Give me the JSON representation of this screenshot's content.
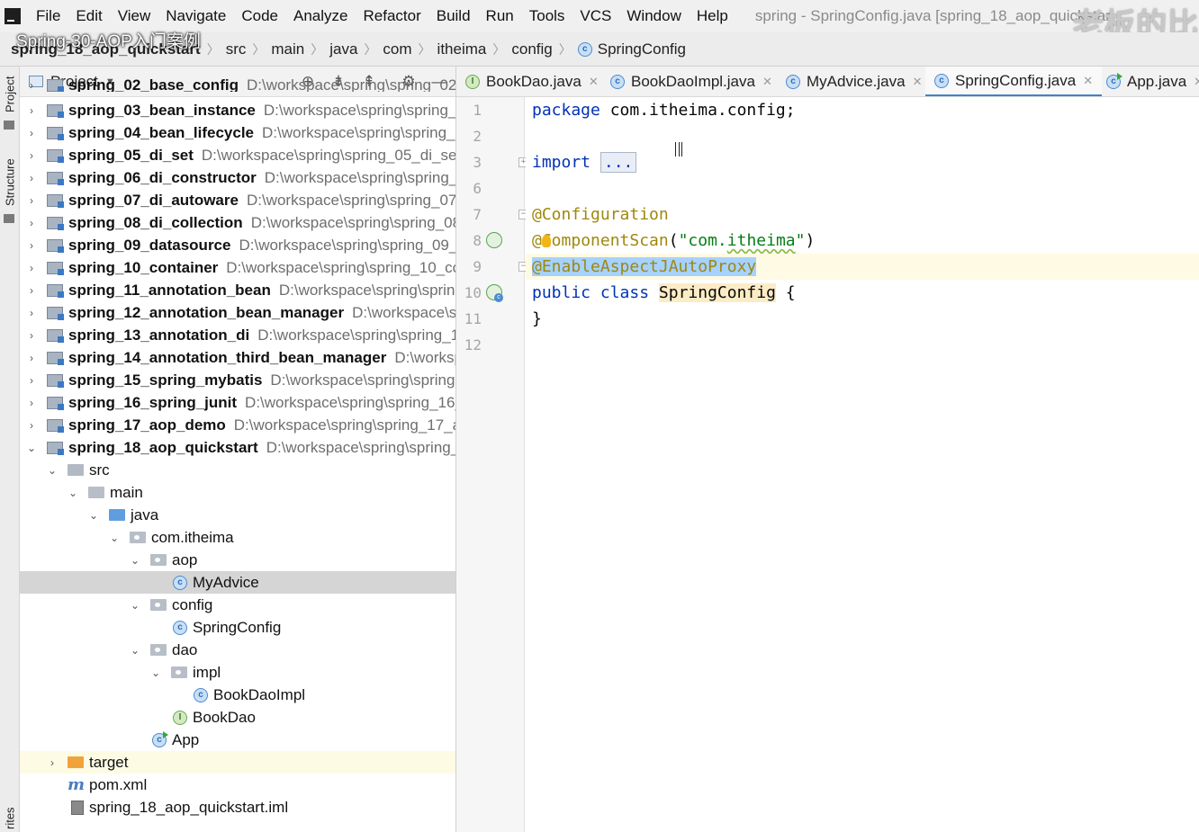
{
  "menubar": {
    "items": [
      "File",
      "Edit",
      "View",
      "Navigate",
      "Code",
      "Analyze",
      "Refactor",
      "Build",
      "Run",
      "Tools",
      "VCS",
      "Window",
      "Help"
    ],
    "window_title": "spring - SpringConfig.java [spring_18_aop_quickstar",
    "watermark": "老板的比"
  },
  "video_title": "Spring-30-AOP入门案例",
  "breadcrumb": [
    "spring_18_aop_quickstart",
    "src",
    "main",
    "java",
    "com",
    "itheima",
    "config",
    "SpringConfig"
  ],
  "left_strip": {
    "project_tab": "Project",
    "structure_tab": "Structure",
    "favorites_tab": "rites"
  },
  "project_panel": {
    "title": "Project",
    "tree": [
      {
        "name": "spring_02_base_config",
        "path": "D:\\workspace\\spring\\spring_02_",
        "bold": true
      },
      {
        "name": "spring_03_bean_instance",
        "path": "D:\\workspace\\spring\\spring_0",
        "bold": true
      },
      {
        "name": "spring_04_bean_lifecycle",
        "path": "D:\\workspace\\spring\\spring_0",
        "bold": true
      },
      {
        "name": "spring_05_di_set",
        "path": "D:\\workspace\\spring\\spring_05_di_set",
        "bold": true
      },
      {
        "name": "spring_06_di_constructor",
        "path": "D:\\workspace\\spring\\spring_",
        "bold": true
      },
      {
        "name": "spring_07_di_autoware",
        "path": "D:\\workspace\\spring\\spring_07",
        "bold": true
      },
      {
        "name": "spring_08_di_collection",
        "path": "D:\\workspace\\spring\\spring_08",
        "bold": true
      },
      {
        "name": "spring_09_datasource",
        "path": "D:\\workspace\\spring\\spring_09_",
        "bold": true
      },
      {
        "name": "spring_10_container",
        "path": "D:\\workspace\\spring\\spring_10_co",
        "bold": true
      },
      {
        "name": "spring_11_annotation_bean",
        "path": "D:\\workspace\\spring\\sprin",
        "bold": true
      },
      {
        "name": "spring_12_annotation_bean_manager",
        "path": "D:\\workspace\\sp",
        "bold": true
      },
      {
        "name": "spring_13_annotation_di",
        "path": "D:\\workspace\\spring\\spring_1",
        "bold": true
      },
      {
        "name": "spring_14_annotation_third_bean_manager",
        "path": "D:\\worksp",
        "bold": true
      },
      {
        "name": "spring_15_spring_mybatis",
        "path": "D:\\workspace\\spring\\spring",
        "bold": true
      },
      {
        "name": "spring_16_spring_junit",
        "path": "D:\\workspace\\spring\\spring_16_",
        "bold": true
      },
      {
        "name": "spring_17_aop_demo",
        "path": "D:\\workspace\\spring\\spring_17_a",
        "bold": true
      },
      {
        "name": "spring_18_aop_quickstart",
        "path": "D:\\workspace\\spring\\spring_",
        "bold": true
      },
      {
        "name": "src",
        "path": ""
      },
      {
        "name": "main",
        "path": ""
      },
      {
        "name": "java",
        "path": ""
      },
      {
        "name": "com.itheima",
        "path": ""
      },
      {
        "name": "aop",
        "path": ""
      },
      {
        "name": "MyAdvice",
        "path": ""
      },
      {
        "name": "config",
        "path": ""
      },
      {
        "name": "SpringConfig",
        "path": ""
      },
      {
        "name": "dao",
        "path": ""
      },
      {
        "name": "impl",
        "path": ""
      },
      {
        "name": "BookDaoImpl",
        "path": ""
      },
      {
        "name": "BookDao",
        "path": ""
      },
      {
        "name": "App",
        "path": ""
      },
      {
        "name": "target",
        "path": ""
      },
      {
        "name": "pom.xml",
        "path": ""
      },
      {
        "name": "spring_18_aop_quickstart.iml",
        "path": ""
      }
    ]
  },
  "editor": {
    "tabs": [
      {
        "label": "BookDao.java",
        "icon": "interface-icon",
        "badge": "I"
      },
      {
        "label": "BookDaoImpl.java",
        "icon": "class-icon",
        "badge": "c"
      },
      {
        "label": "MyAdvice.java",
        "icon": "class-icon",
        "badge": "c"
      },
      {
        "label": "SpringConfig.java",
        "icon": "class-icon",
        "badge": "c",
        "active": true
      },
      {
        "label": "App.java",
        "icon": "runnable-class-icon",
        "badge": "c"
      }
    ],
    "line_numbers": [
      "1",
      "2",
      "3",
      "6",
      "7",
      "8",
      "9",
      "10",
      "11",
      "12"
    ],
    "code": {
      "package_kw": "package",
      "package_name": " com.itheima.config;",
      "import_kw": "import",
      "import_folded": "...",
      "ann_configuration": "@Configuration",
      "ann_cs_at": "@",
      "ann_cs_rest": "ComponentScan",
      "cs_open": "(",
      "cs_str_q1": "\"com.",
      "cs_str_word": "itheima",
      "cs_str_q2": "\"",
      "cs_close": ")",
      "ann_enable": "@EnableAspectJAutoProxy",
      "public_class_kw": "public class",
      "class_name": "SpringConfig",
      "open_brace": " {",
      "close_brace": "}"
    }
  },
  "colors": {
    "keyword": "#0033b3",
    "annotation": "#9e880d",
    "string": "#067d17",
    "selection": "#a6d2ff",
    "accent": "#4083c9"
  }
}
